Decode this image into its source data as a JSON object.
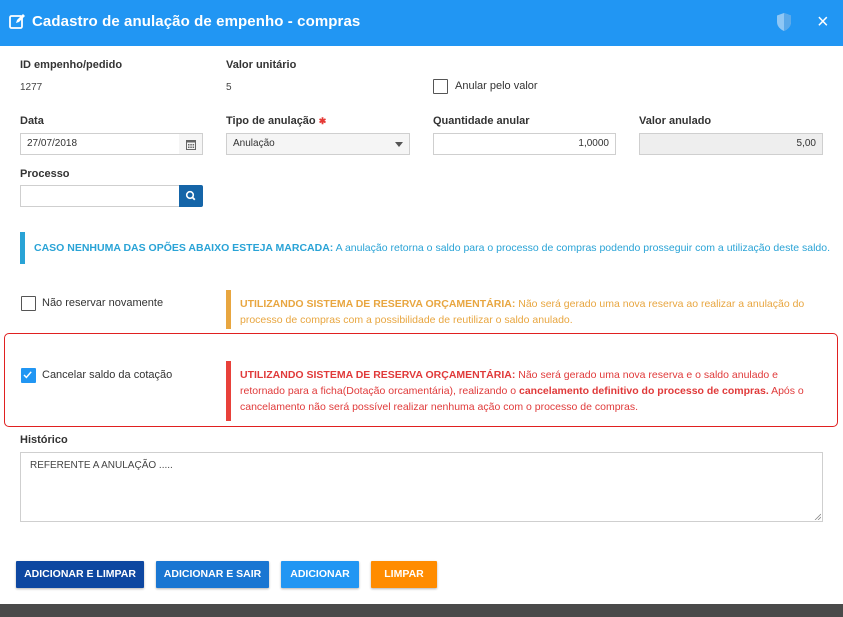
{
  "header": {
    "title": "Cadastro de anulação de empenho - compras",
    "icons": [
      "edit-icon",
      "shield-icon",
      "close-icon"
    ],
    "close_label": "×"
  },
  "fields": {
    "id_label": "ID empenho/pedido",
    "id_value": "1277",
    "unit_label": "Valor unitário",
    "unit_value": "5",
    "annul_by_value_label": "Anular pelo valor",
    "date_label": "Data",
    "date_value": "27/07/2018",
    "type_label": "Tipo de anulação",
    "required_mark": "✱",
    "type_value": "Anulação",
    "qty_label": "Quantidade anular",
    "qty_value": "1,0000",
    "annulled_label": "Valor anulado",
    "annulled_value": "5,00",
    "process_label": "Processo",
    "process_value": ""
  },
  "info": {
    "bold": "CASO NENHUMA DAS OPÕES ABAIXO ESTEJA MARCADA:",
    "text": " A anulação retorna o saldo para o processo de compras podendo prosseguir com a utilização deste saldo."
  },
  "options": {
    "no_reserve_label": "Não reservar novamente",
    "no_reserve_checked": false,
    "no_reserve_bold": "UTILIZANDO SISTEMA DE RESERVA ORÇAMENTÁRIA:",
    "no_reserve_text": " Não será gerado uma nova reserva ao realizar a anulação do processo de compras com a possibilidade de reutilizar o saldo anulado.",
    "cancel_label": "Cancelar saldo da cotação",
    "cancel_checked": true,
    "cancel_bold": "UTILIZANDO SISTEMA DE RESERVA ORÇAMENTÁRIA:",
    "cancel_text1": " Não será gerado uma nova reserva e o saldo anulado e retornado para a ficha(Dotação orcamentária), realizando o ",
    "cancel_bold2": "cancelamento definitivo do processo de compras.",
    "cancel_text2": " Após o cancelamento não será possível realizar nenhuma ação com o processo de compras."
  },
  "history": {
    "label": "Histórico",
    "value": "REFERENTE A ANULAÇÃO ....."
  },
  "buttons": {
    "add_clear": "ADICIONAR E LIMPAR",
    "add_exit": "ADICIONAR E SAIR",
    "add": "ADICIONAR",
    "clear": "LIMPAR"
  },
  "colors": {
    "header": "#2196f3",
    "info": "#29a3d6",
    "warning": "#e8a640",
    "danger": "#e8413a",
    "btn_add_clear": "#0d47a1",
    "btn_add_exit": "#1976d2",
    "btn_add": "#2196f3",
    "btn_clear": "#ff8c00"
  }
}
